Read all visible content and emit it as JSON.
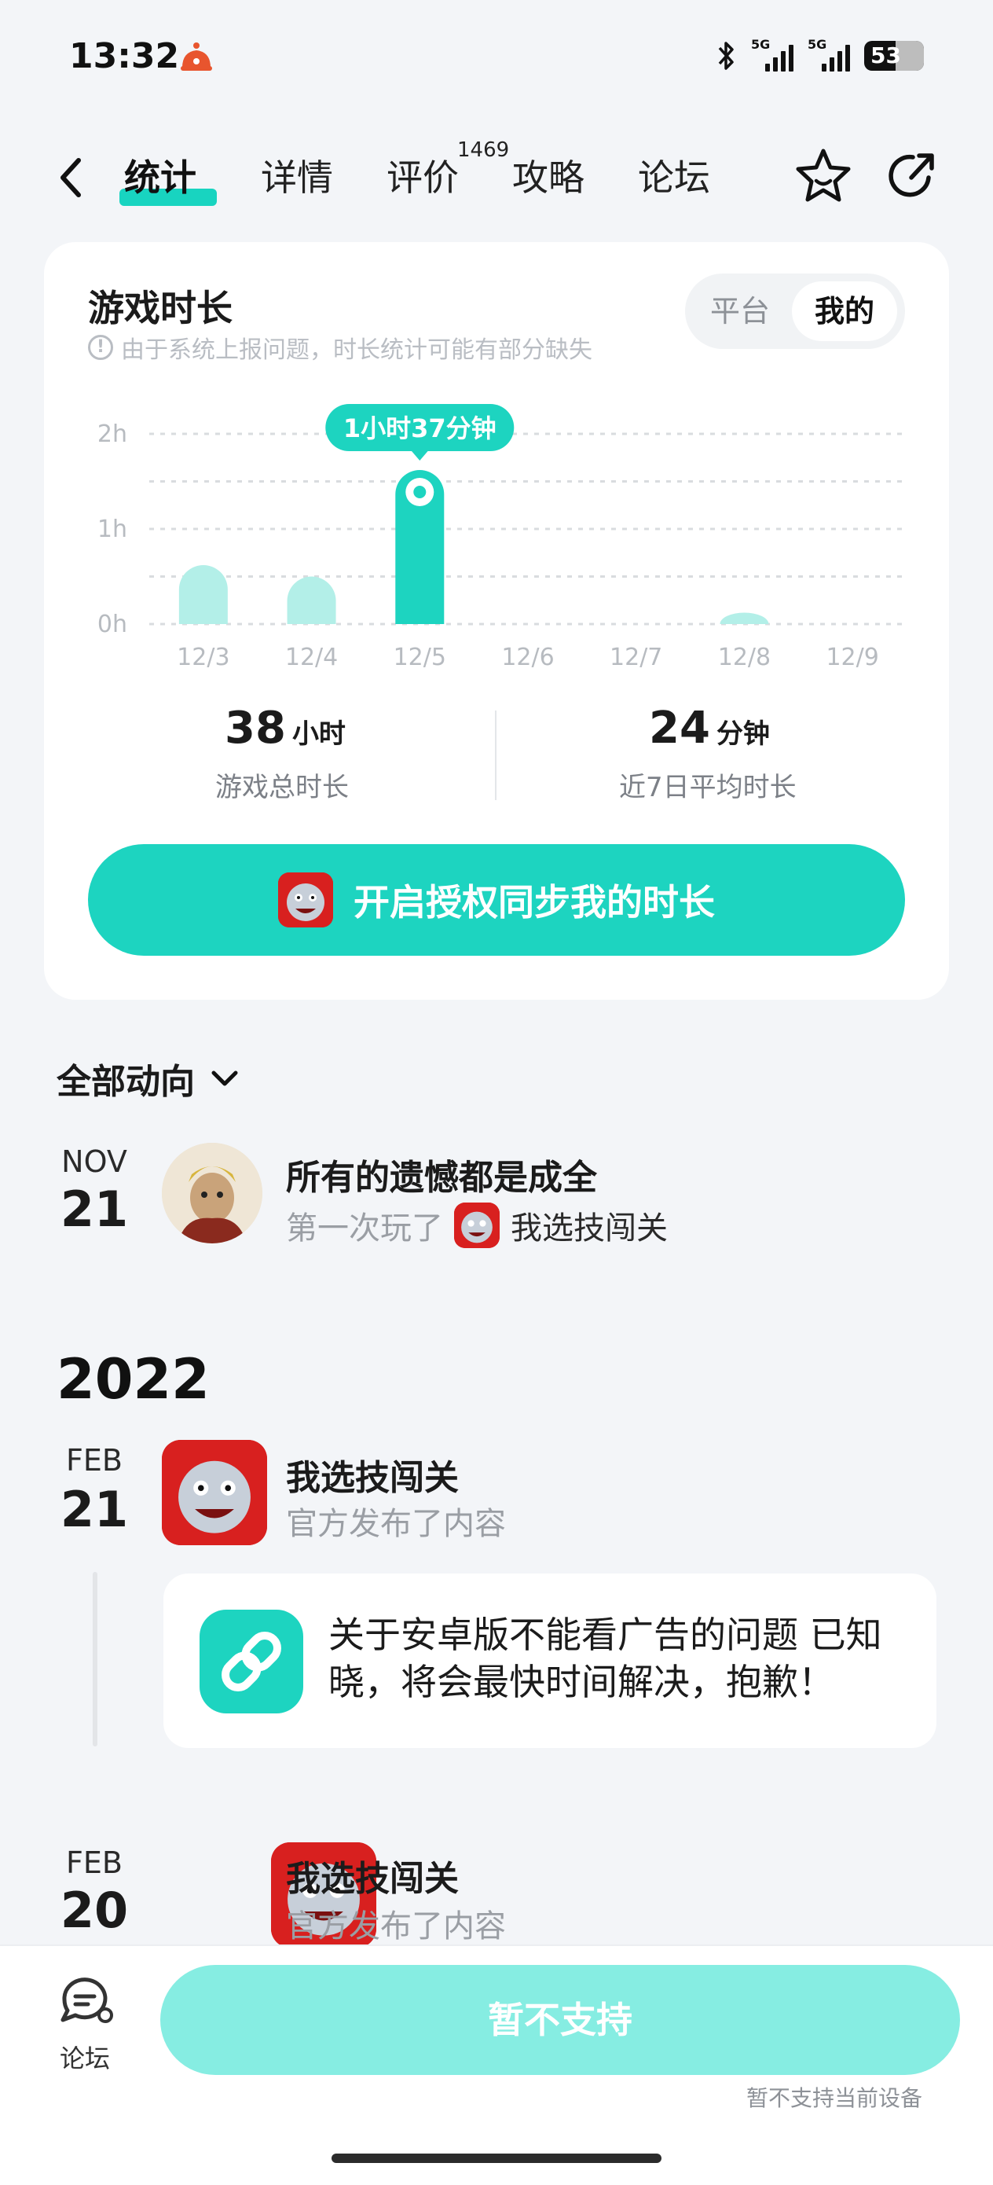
{
  "status_bar": {
    "time": "13:32",
    "battery": "53",
    "network_1": "5G",
    "network_2": "5G"
  },
  "nav": {
    "tabs": [
      {
        "label": "统计",
        "active": true
      },
      {
        "label": "详情",
        "active": false
      },
      {
        "label": "评价",
        "active": false,
        "badge": "1469"
      },
      {
        "label": "攻略",
        "active": false
      },
      {
        "label": "论坛",
        "active": false
      }
    ],
    "icons": {
      "back": "chevron-left-icon",
      "favorite": "star-face-icon",
      "share": "share-icon"
    }
  },
  "playtime_card": {
    "title": "游戏时长",
    "note": "由于系统上报问题，时长统计可能有部分缺失",
    "toggle": {
      "options": [
        "平台",
        "我的"
      ],
      "selected": "我的"
    },
    "total": {
      "value": "38",
      "unit": "小时",
      "label": "游戏总时长"
    },
    "average": {
      "value": "24",
      "unit": "分钟",
      "label": "近7日平均时长"
    },
    "auth_button": "开启授权同步我的时长"
  },
  "chart_data": {
    "type": "bar",
    "categories": [
      "12/3",
      "12/4",
      "12/5",
      "12/6",
      "12/7",
      "12/8",
      "12/9"
    ],
    "values": [
      0.62,
      0.5,
      1.62,
      0,
      0,
      0.12,
      0
    ],
    "yticks": [
      "0h",
      "1h",
      "2h"
    ],
    "ylim": [
      0,
      2
    ],
    "highlight_index": 2,
    "highlight_label": "1小时37分钟",
    "colors": {
      "bar": "#b3efe8",
      "highlight": "#1dd4c0",
      "grid": "#d9dcdf",
      "tick": "#b7bbc0"
    }
  },
  "feed": {
    "filter_label": "全部动向",
    "items": [
      {
        "month": "NOV",
        "day": "21",
        "title": "所有的遗憾都是成全",
        "sub_prefix": "第一次玩了",
        "sub_game": "我选技闯关"
      }
    ],
    "year": "2022",
    "posts": [
      {
        "month": "FEB",
        "day": "21",
        "title": "我选技闯关",
        "sub": "官方发布了内容",
        "content": "关于安卓版不能看广告的问题 已知晓，将会最快时间解决，抱歉！"
      },
      {
        "month": "FEB",
        "day": "20",
        "title": "我选技闯关",
        "sub": "官方发布了内容"
      }
    ]
  },
  "bottom_bar": {
    "forum_label": "论坛",
    "button_label": "暂不支持",
    "note": "暂不支持当前设备"
  }
}
